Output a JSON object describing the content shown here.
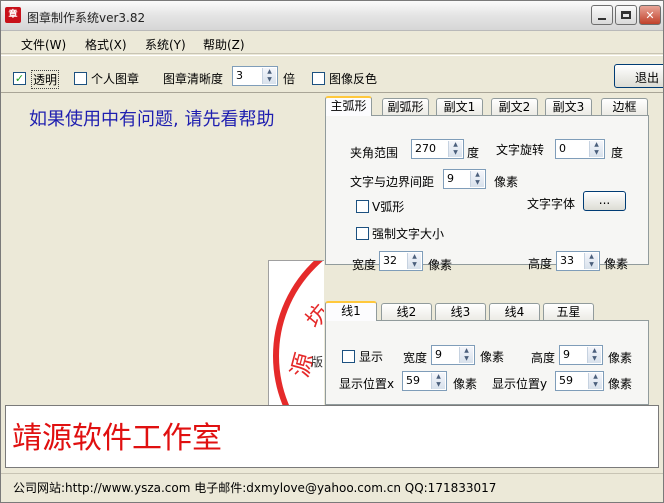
{
  "window": {
    "title": "图章制作系统ver3.82",
    "app_icon_text": "章"
  },
  "menu": [
    "文件(W)",
    "格式(X)",
    "系统(Y)",
    "帮助(Z)"
  ],
  "toolbar": {
    "transparent": {
      "label": "透明",
      "checked": true
    },
    "personal_seal": {
      "label": "个人图章",
      "checked": false
    },
    "clarity_label": "图章清晰度",
    "clarity_value": "3",
    "clarity_unit": "倍",
    "invert": {
      "label": "图像反色",
      "checked": false
    },
    "exit_label": "退出"
  },
  "help_text": "如果使用中有问题, 请先看帮助",
  "seal_text": {
    "char1": "源",
    "char2": "坊",
    "small": "版"
  },
  "panel1": {
    "tabs": [
      "主弧形",
      "副弧形",
      "副文1",
      "副文2",
      "副文3",
      "边框"
    ],
    "active_tab": 0,
    "angle_label": "夹角范围",
    "angle_value": "270",
    "angle_unit": "度",
    "rotate_label": "文字旋转",
    "rotate_value": "0",
    "rotate_unit": "度",
    "gap_label": "文字与边界间距",
    "gap_value": "9",
    "gap_unit": "像素",
    "v_arc_label": "V弧形",
    "font_label": "文字字体",
    "font_button": "...",
    "force_size_label": "强制文字大小",
    "width_label": "宽度",
    "width_value": "32",
    "width_unit": "像素",
    "height_label": "高度",
    "height_value": "33",
    "height_unit": "像素"
  },
  "panel2": {
    "tabs": [
      "线1",
      "线2",
      "线3",
      "线4",
      "五星"
    ],
    "active_tab": 0,
    "show_label": "显示",
    "width_label": "宽度",
    "width_value": "9",
    "width_unit": "像素",
    "height_label": "高度",
    "height_value": "9",
    "height_unit": "像素",
    "posx_label": "显示位置x",
    "posx_value": "59",
    "posx_unit": "像素",
    "posy_label": "显示位置y",
    "posy_value": "59",
    "posy_unit": "像素"
  },
  "bottom_text": "靖源软件工作室",
  "status": "公司网站:http://www.ysza.com 电子邮件:dxmylove@yahoo.com.cn QQ:171833017"
}
